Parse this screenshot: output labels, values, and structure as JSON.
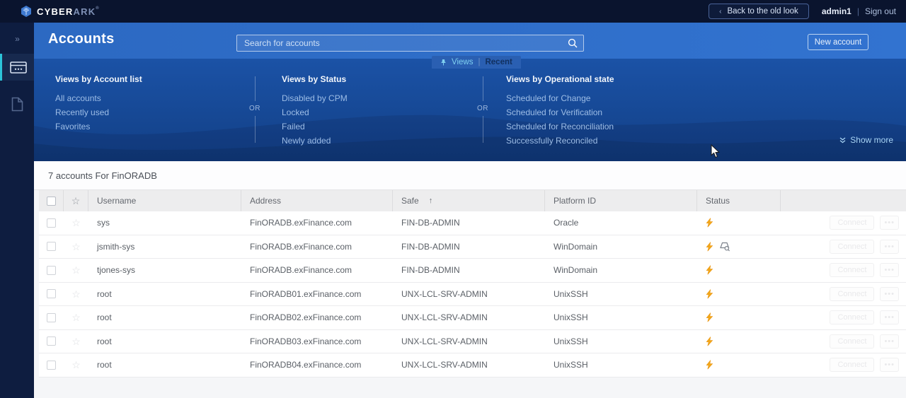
{
  "topbar": {
    "brand_primary": "CYBER",
    "brand_secondary": "ARK",
    "brand_reg": "®",
    "back_chevron": "‹",
    "back_button": "Back to the old look",
    "username": "admin1",
    "divider": "|",
    "sign_out": "Sign out"
  },
  "sidebar": {
    "expand_glyph": "»"
  },
  "header": {
    "title": "Accounts",
    "search_placeholder": "Search for accounts",
    "new_account": "New account"
  },
  "views_tab": {
    "views": "Views",
    "separator": "|",
    "recent": "Recent"
  },
  "views_panel": {
    "or_label": "OR",
    "show_more": "Show more",
    "columns": [
      {
        "heading": "Views by Account list",
        "items": [
          "All accounts",
          "Recently used",
          "Favorites"
        ]
      },
      {
        "heading": "Views by Status",
        "items": [
          "Disabled by CPM",
          "Locked",
          "Failed",
          "Newly added"
        ]
      },
      {
        "heading": "Views by Operational state",
        "items": [
          "Scheduled for Change",
          "Scheduled for Verification",
          "Scheduled for Reconciliation",
          "Successfully Reconciled"
        ]
      }
    ]
  },
  "table": {
    "summary": "7 accounts For FinORADB",
    "columns": [
      "Username",
      "Address",
      "Safe",
      "Platform ID",
      "Status"
    ],
    "sorted_column": "Safe",
    "sort_direction_glyph": "↑",
    "row_actions": {
      "connect": "Connect",
      "more": "•••"
    },
    "rows": [
      {
        "username": "sys",
        "address": "FinORADB.exFinance.com",
        "safe": "FIN-DB-ADMIN",
        "platform": "Oracle",
        "status_icons": [
          "lightning"
        ]
      },
      {
        "username": "jsmith-sys",
        "address": "FinORADB.exFinance.com",
        "safe": "FIN-DB-ADMIN",
        "platform": "WinDomain",
        "status_icons": [
          "lightning",
          "review"
        ]
      },
      {
        "username": "tjones-sys",
        "address": "FinORADB.exFinance.com",
        "safe": "FIN-DB-ADMIN",
        "platform": "WinDomain",
        "status_icons": [
          "lightning"
        ]
      },
      {
        "username": "root",
        "address": "FinORADB01.exFinance.com",
        "safe": "UNX-LCL-SRV-ADMIN",
        "platform": "UnixSSH",
        "status_icons": [
          "lightning"
        ]
      },
      {
        "username": "root",
        "address": "FinORADB02.exFinance.com",
        "safe": "UNX-LCL-SRV-ADMIN",
        "platform": "UnixSSH",
        "status_icons": [
          "lightning"
        ]
      },
      {
        "username": "root",
        "address": "FinORADB03.exFinance.com",
        "safe": "UNX-LCL-SRV-ADMIN",
        "platform": "UnixSSH",
        "status_icons": [
          "lightning"
        ]
      },
      {
        "username": "root",
        "address": "FinORADB04.exFinance.com",
        "safe": "UNX-LCL-SRV-ADMIN",
        "platform": "UnixSSH",
        "status_icons": [
          "lightning"
        ]
      }
    ]
  },
  "colors": {
    "topbar_bg": "#0a142e",
    "sidebar_bg": "#0e1d40",
    "header_blue": "#2e6ec8",
    "panel_blue": "#174a98",
    "active_cyan": "#2cc4d9",
    "status_yellow": "#f3a819",
    "tab_views_text": "#7fd0f0"
  }
}
